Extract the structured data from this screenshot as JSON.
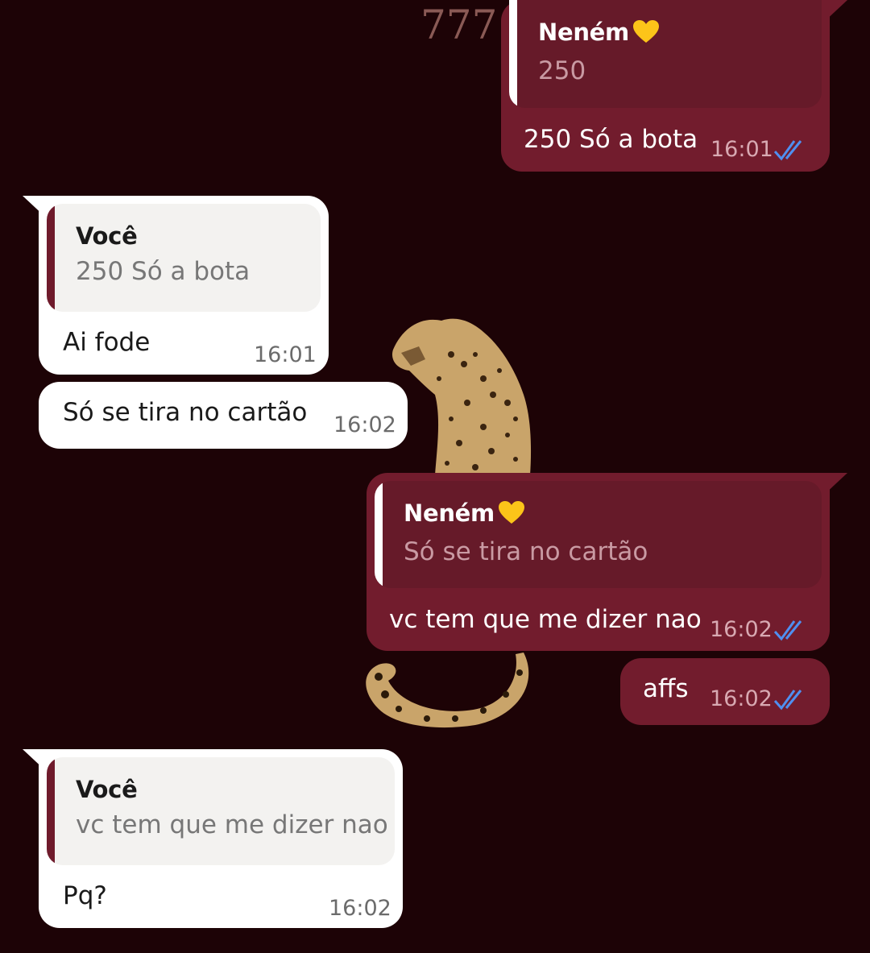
{
  "colors": {
    "background": "#1d0306",
    "outgoing_bubble": "#721c2d",
    "incoming_bubble": "#ffffff",
    "read_ticks": "#4f8ff0"
  },
  "wallpaper": {
    "text": "777"
  },
  "messages": [
    {
      "direction": "outgoing",
      "quote": {
        "author": "Neném",
        "emoji": "yellow-heart",
        "text": "250"
      },
      "text": "250 Só a bota",
      "time": "16:01",
      "status": "read"
    },
    {
      "direction": "incoming",
      "quote": {
        "author": "Você",
        "text": "250 Só a bota"
      },
      "text": "Ai fode",
      "time": "16:01"
    },
    {
      "direction": "incoming",
      "text": "Só se tira no cartão",
      "time": "16:02"
    },
    {
      "direction": "outgoing",
      "quote": {
        "author": "Neném",
        "emoji": "yellow-heart",
        "text": "Só se tira no cartão"
      },
      "text": "vc tem que me dizer nao",
      "time": "16:02",
      "status": "read"
    },
    {
      "direction": "outgoing",
      "text": "affs",
      "time": "16:02",
      "status": "read"
    },
    {
      "direction": "incoming",
      "quote": {
        "author": "Você",
        "text": "vc tem que me dizer nao"
      },
      "text": "Pq?",
      "time": "16:02"
    }
  ]
}
